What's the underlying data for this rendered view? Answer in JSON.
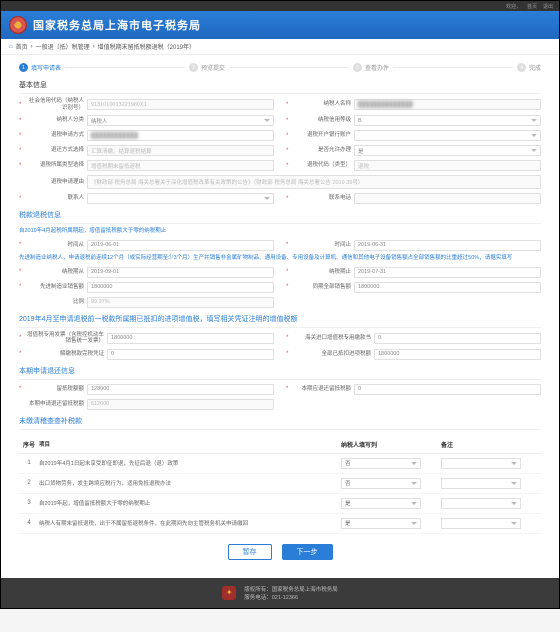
{
  "topbar": {
    "welcome": "欢迎，",
    "links": [
      "首页",
      "退出"
    ]
  },
  "banner": {
    "title": "国家税务总局上海市电子税务局"
  },
  "crumbs": {
    "home": "首页",
    "items": [
      "一般退（抵）税管理",
      "增值税期末留抵税额退税（2019年）"
    ]
  },
  "steps": [
    {
      "n": "1",
      "label": "填写申请表"
    },
    {
      "n": "2",
      "label": "预览提交"
    },
    {
      "n": "3",
      "label": "查看办件"
    },
    {
      "n": "4",
      "label": "完成"
    }
  ],
  "sect": {
    "basic": "基本信息",
    "period": "税款退税信息",
    "adv": "2019年4月至申请退税前一税款所属期已抵扣的进项增值税，填写相关凭证注明的增值税额",
    "curr": "本期申请退还信息",
    "unused": "未缴清稽查查补税款"
  },
  "f": {
    "creditCodeLbl": "社会信用代码（纳税人识别号）",
    "creditCode": "9131010013221980X1",
    "nameLbl": "纳税人名称",
    "name": "██████████████",
    "typeLbl": "纳税人分类",
    "type": "纳税人",
    "creditLevelLbl": "纳税信用等级",
    "creditLevel": "B",
    "addrLbl": "退税申请方式",
    "addr": "████████████",
    "acctLbl": "退税开户银行账户",
    "acct": "",
    "applyTypeLbl": "退还方式选择",
    "applyType": "汇算清缴、结算退税结算",
    "riskLbl": "是否允许办理",
    "risk": "是",
    "refundTypeLbl": "退税所属类型选择",
    "refundType": "增值税期末留抵退税",
    "caseLbl": "退税代码（类型）",
    "case": "退税",
    "basisLbl": "退税申请理由",
    "basis": "《财政部 税务总局 海关总署关于深化增值税改革有关政策的公告》（财政部 税务总局 海关总署公告 2019 39号）",
    "contactLbl": "联系人",
    "contact": "",
    "phoneLbl": "联系电话",
    "phone": "",
    "hint1": "自2019年4月起税所属期起，增值留抵税额大于零的纳税期止",
    "periodFromLbl": "时间从",
    "periodFrom": "2019-06-01",
    "periodToLbl": "时间止",
    "periodTo": "2019-06-31",
    "hint2": "先进制造业纳税人，申请退税前连续12个月（或实际经营期至少3个月）生产并销售非金属矿物制品、通用设备、专用设备及计算机、通信和其他电子设备销售额占全部销售额的比重超过50%，请据实填写",
    "mfgFromLbl": "纳税期从",
    "mfgFrom": "2019-09-01",
    "mfgToLbl": "纳税期止",
    "mfgTo": "2019-07-31",
    "mfgSalesLbl": "先进制造业销售额",
    "mfgSales": "1800000",
    "allSalesLbl": "同期全部销售额",
    "allSales": "1800000",
    "ratioLbl": "比例",
    "ratio": "99.97%",
    "vatInvLbl": "增值税专用发票（含税控机动车销售统一发票）",
    "vatInv": "1800000",
    "customsLbl": "海关进口增值税专用缴款书",
    "customs": "0",
    "taxPaidLbl": "解缴税款完税凭证",
    "taxPaid": "0",
    "totalInLbl": "全部已抵扣进项税额",
    "totalIn": "1800000",
    "retainLbl": "留抵税额额",
    "retain": "128000",
    "auditLbl": "本期应退还留抵税额",
    "audit": "0",
    "applyAmtLbl": "本期申请退还留抵税额",
    "applyAmt": "512000"
  },
  "table": {
    "headers": {
      "idx": "序号",
      "item": "项目",
      "ans": "纳税人填写列",
      "note": "备注"
    },
    "rows": [
      {
        "idx": "1",
        "item": "自2019年4月1日起未享受即征即退，先征后退（退）政策",
        "ans": "否"
      },
      {
        "idx": "2",
        "item": "出口货物劳务，发生跨境应税行为，适用免抵退税办法",
        "ans": "否"
      },
      {
        "idx": "3",
        "item": "自2019年起，增值留抵税额大于零的纳税期止",
        "ans": "是"
      },
      {
        "idx": "4",
        "item": "纳税人有期末留抵退税，出于不属留抵退税条件，在此期间先向主管税务机关申请缴回",
        "ans": "是"
      }
    ]
  },
  "actions": {
    "print": "暂存",
    "next": "下一步"
  },
  "footer": {
    "l1": "版权所有：国家税务总局上海市税务局",
    "l2": "服务电话：021-12366"
  }
}
